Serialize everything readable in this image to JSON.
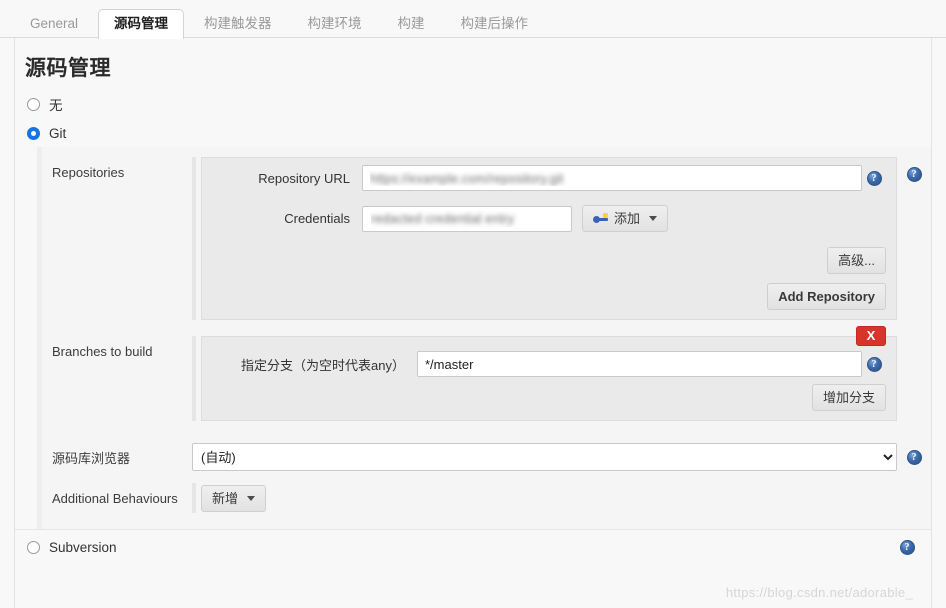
{
  "tabs": [
    {
      "label": "General",
      "active": false
    },
    {
      "label": "源码管理",
      "active": true
    },
    {
      "label": "构建触发器",
      "active": false
    },
    {
      "label": "构建环境",
      "active": false
    },
    {
      "label": "构建",
      "active": false
    },
    {
      "label": "构建后操作",
      "active": false
    }
  ],
  "page": {
    "title": "源码管理",
    "watermark": "https://blog.csdn.net/adorable_"
  },
  "scm_options": {
    "none_label": "无",
    "git_label": "Git",
    "subversion_label": "Subversion",
    "selected": "Git"
  },
  "repositories": {
    "section_label": "Repositories",
    "url_label": "Repository URL",
    "url_value": "https://example.com/repository.git",
    "credentials_label": "Credentials",
    "credentials_value": "redacted credential entry",
    "add_credentials_label": "添加",
    "add_credentials_icon": "key-icon",
    "advanced_label": "高级...",
    "add_repository_label": "Add Repository"
  },
  "branches": {
    "section_label": "Branches to build",
    "specifier_label": "指定分支（为空时代表any）",
    "specifier_value": "*/master",
    "add_branch_label": "增加分支",
    "delete_label": "X"
  },
  "browser": {
    "label": "源码库浏览器",
    "value": "(自动)"
  },
  "additional_behaviours": {
    "label": "Additional Behaviours",
    "add_label": "新增"
  },
  "icons": {
    "help": "?"
  },
  "colors": {
    "accent": "#1675e0",
    "danger": "#d9342b",
    "panel": "#eaeaea",
    "page_bg": "#f8f8f8"
  }
}
